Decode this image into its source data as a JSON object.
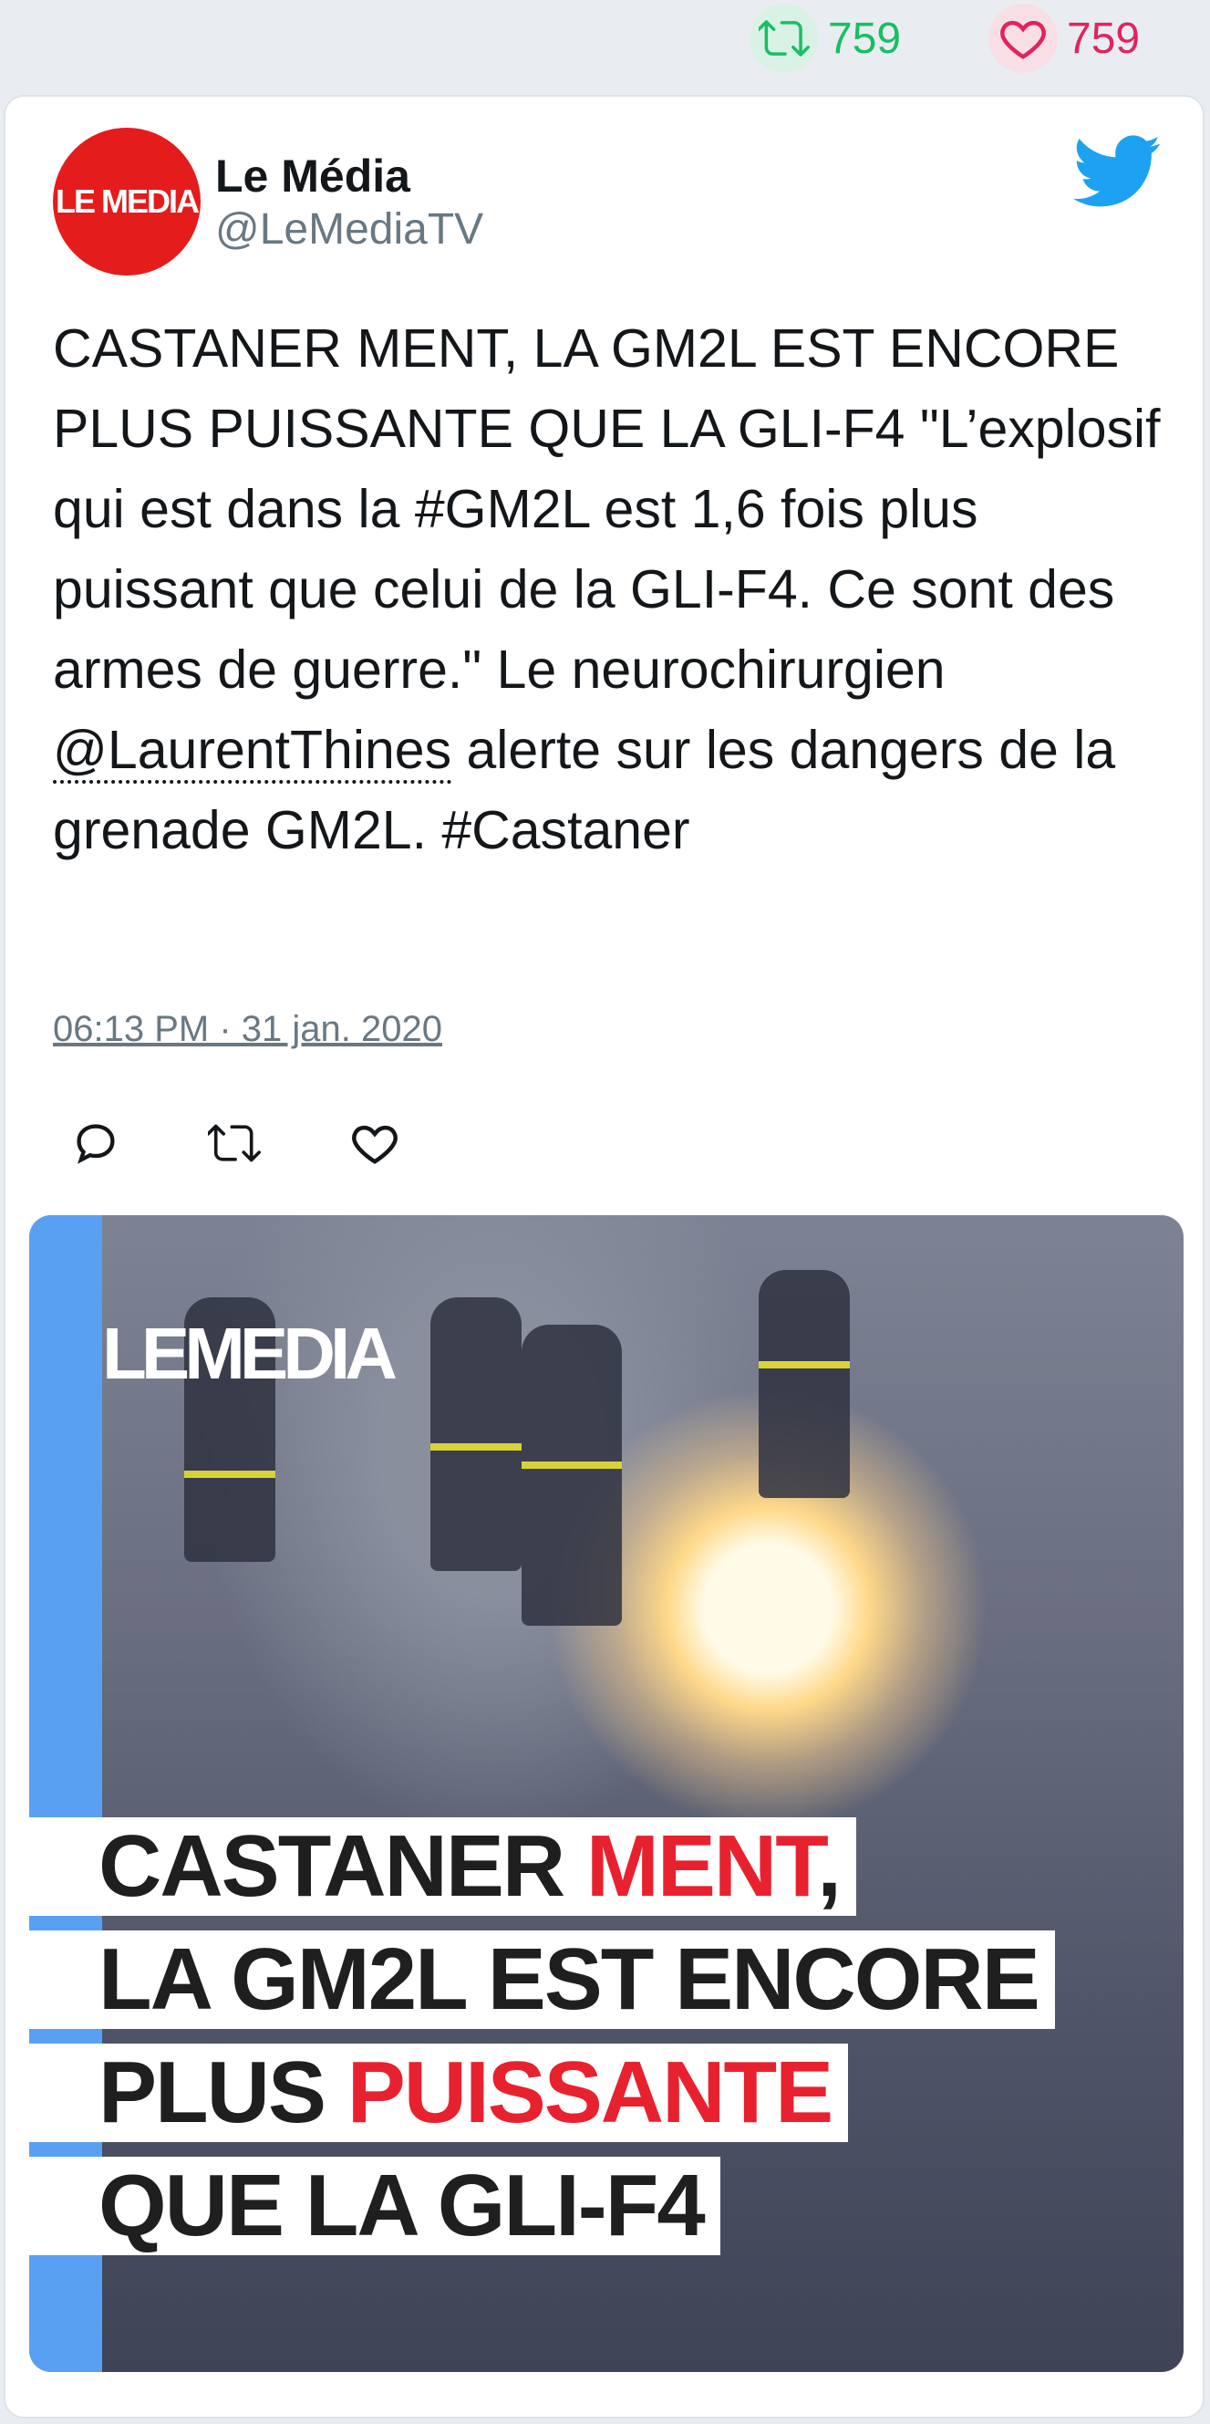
{
  "top_stats": {
    "retweets": "759",
    "likes": "759",
    "retweet_color": "#17bf63",
    "like_color": "#e0245e"
  },
  "tweet": {
    "avatar_text": "LE MEDIA",
    "author_name": "Le Média",
    "author_handle": "@LeMediaTV",
    "text_part1": "CASTANER MENT, LA GM2L EST ENCORE PLUS PUISSANTE QUE LA GLI-F4 \"L’explosif qui est dans la #GM2L est 1,6 fois plus puissant que celui de la GLI-F4. Ce sont des armes de guerre.\" Le neurochirurgien ",
    "mention": "@LaurentThines",
    "text_part2": " alerte sur les dangers de la grenade GM2L. #Castaner",
    "timestamp": "06:13 PM · 31 jan. 2020",
    "actions": [
      "reply-icon",
      "retweet-icon",
      "like-icon"
    ]
  },
  "media": {
    "logo": "LEMEDIA",
    "headline": [
      {
        "a": "CASTANER ",
        "b": "MENT",
        "c": ","
      },
      {
        "a": "LA GM2L EST ENCORE",
        "b": "",
        "c": ""
      },
      {
        "a": "PLUS ",
        "b": "PUISSANTE",
        "c": ""
      },
      {
        "a": "QUE LA GLI-F4",
        "b": "",
        "c": ""
      }
    ]
  }
}
